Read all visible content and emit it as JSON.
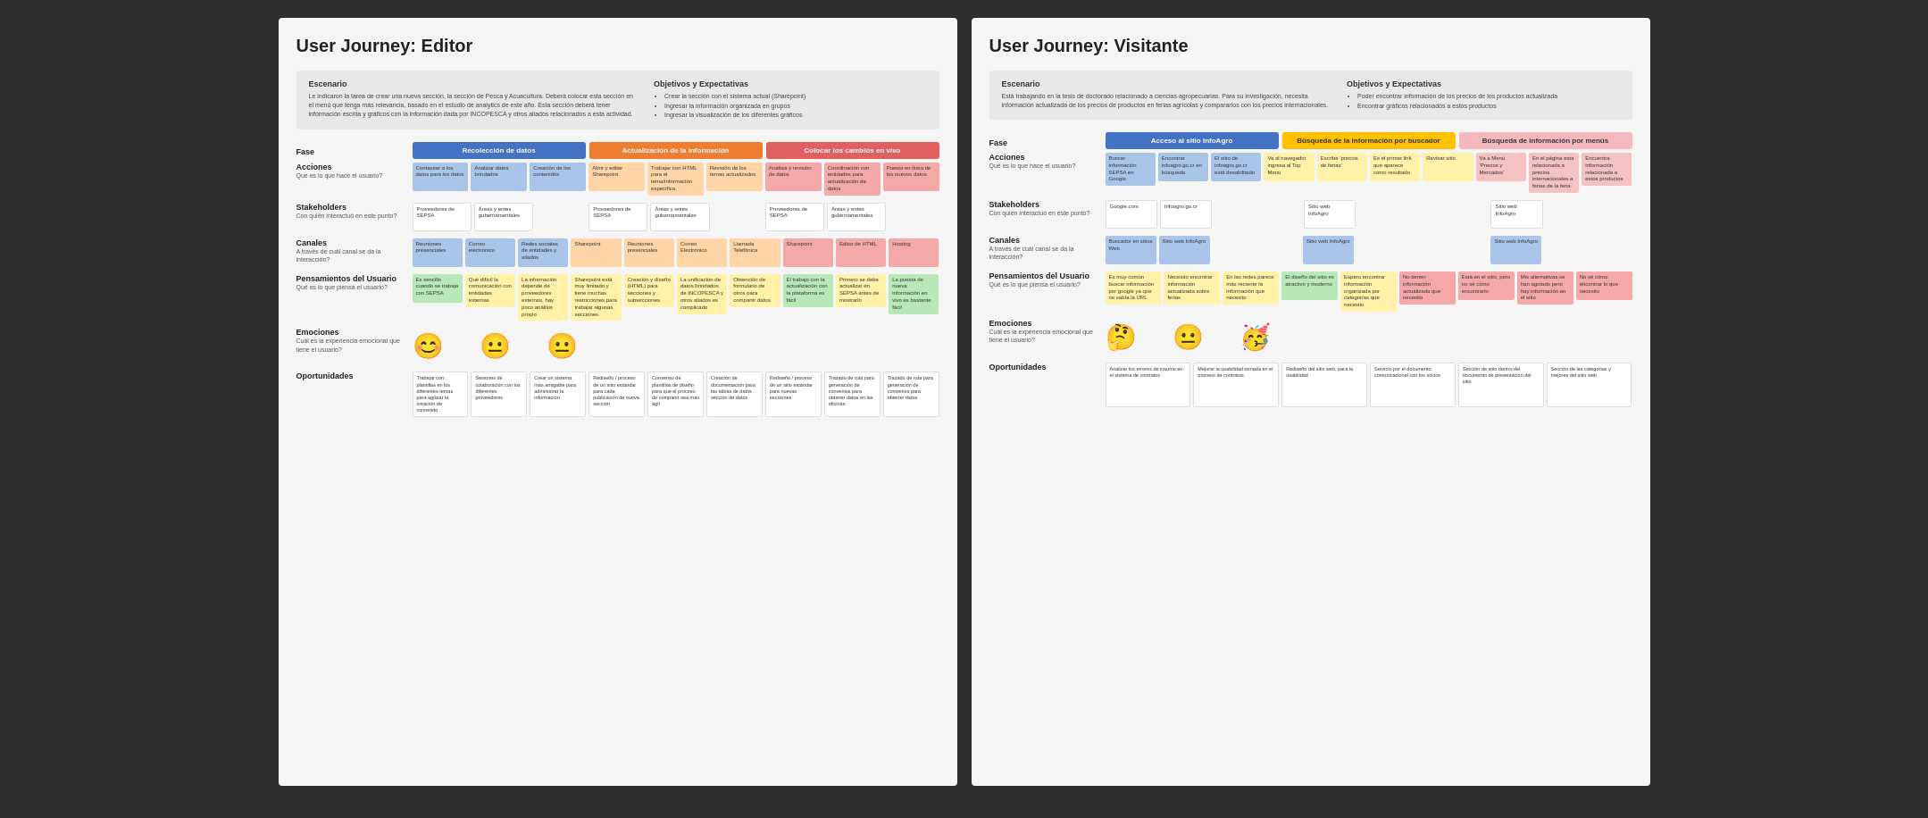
{
  "board1": {
    "title": "User Journey: Editor",
    "scenario": {
      "left_title": "Escenario",
      "left_text": "Le indicaron la tarea de crear una nueva sección, la sección de Pesca y Acuacultura. Deberá colocar esta sección en el menú que tenga más relevancia, basado en el estudio de analytics de este año. Esta sección deberá tener información escrita y gráficos con la información dada por INCOPESCA y otros aliados relacionados a esta actividad.",
      "right_title": "Objetivos y Expectativas",
      "right_items": [
        "Crear la sección con el sistema actual (Sharepoint)",
        "Ingresar la información organizada en grupos",
        "Ingresar la visualización de los diferentes gráficos"
      ]
    },
    "phases": {
      "label": "Fase",
      "items": [
        "Recolección de datos",
        "Actualización de la información",
        "Colocar los cambios en vivo"
      ]
    },
    "acciones": {
      "title": "Acciones",
      "subtitle": "Qué es lo que hace el usuario?",
      "col1": [
        "Contacear a los datos para los datos",
        "Analizar datos brindados",
        "Creación de los contenidos"
      ],
      "col2": [
        "Abrir y editar Sharepoint",
        "Trabajar con HTML para el tema/información específica",
        "Revisión de los temas actualizados"
      ],
      "col3": [
        "Análisis y revisión de datos",
        "Coordinación con entidades para actualización de datos",
        "Puesta en linea de los nuevos datos"
      ]
    },
    "stakeholders": {
      "title": "Stakeholders",
      "subtitle": "Con quién interactuó en este punto?",
      "col1": [
        "Proveedores de SEPSA",
        "Áreas y entes gubernamentales"
      ],
      "col2": [
        "Proveedores de SEPSA",
        "Áreas y entes gubernamentales"
      ],
      "col3": [
        "Proveedores de SEPSA",
        "Áreas y entes gubernamentales"
      ]
    },
    "canales": {
      "title": "Canales",
      "subtitle": "A través de cuál canal se da la interacción?",
      "col1": [
        "Reuniones presenciales",
        "Correo electrónico",
        "Redes sociales de entidades y aliados"
      ],
      "col2": [
        "Sharepoint",
        "Reuniones presenciales",
        "Correo Electrónico",
        "Llamada Telefónica"
      ],
      "col3": [
        "Sharepoint",
        "Editor de HTML",
        "Hosting"
      ]
    },
    "pensamientos": {
      "title": "Pensamientos del Usuario",
      "subtitle": "Qué es lo que piensa el usuario?",
      "col1": [
        "Es sencillo cuando se trabaja con SEPSA",
        "Qué difícil la comunicación con entidades externas",
        "La información depende de proveedores externos, hay poco análisis propio"
      ],
      "col2": [
        "Sharepoint está muy limitado y tiene muchas restricciones para trabajar algunas secciones",
        "Creación y diseño (HTML) para secciones y subsecciones",
        "La unificación de datos brindados de INCOPESCA y otros aliados es complicado",
        "Obtención de formulario de otros para compartir datos"
      ],
      "col3": [
        "El trabajo con la actualización con la plataforma es fácil",
        "Primero se debe actualizar en SEPSA antes de mostrarlo",
        "La puesta de nueva información en vivo es bastante fácil"
      ]
    },
    "emociones": {
      "title": "Emociones",
      "subtitle": "Cuál es la experiencia emocional que tiene el usuario?",
      "emojis": [
        "😊",
        "😐",
        "😐"
      ]
    },
    "oportunidades": {
      "title": "Oportunidades",
      "items": [
        "Trabajar con plantillas en los diferentes temas para agilizar la creación de contenido",
        "Sesiones de colaboración con los diferentes proveedores",
        "Crear un sistema más amigable para administrar la información",
        "Rediseño / proceso de un sitio estándar para cada publicación de nueva sección",
        "Consenso de plantillas de diseño para que el proceso de compartir sea más ágil",
        "Creación de documentación para las tablas de datos sección de datos",
        "Rediseño / proceso de un sitio estándar para nuevas secciones",
        "Trazado de ruta para generación de convenios para obtener datos en las oficinas",
        "Trazado de ruta para generación de convenios para obtener datos"
      ]
    }
  },
  "board2": {
    "title": "User Journey: Visitante",
    "scenario": {
      "left_title": "Escenario",
      "left_text": "Está trabajando en la tesis de doctorado relacionado a ciencias agropecuarias. Para su investigación, necesita información actualizada de los precios de productos en ferias agrícolas y compararlos con los precios internacionales.",
      "right_title": "Objetivos y Expectativas",
      "right_items": [
        "Poder encontrar información de los precios de los productos actualizada",
        "Encontrar gráficos relacionados a estos productos"
      ]
    },
    "phases": {
      "label": "Fase",
      "items": [
        "Acceso al sitio InfoAgro",
        "Búsqueda de la información por buscador",
        "Búsqueda de información por menús"
      ]
    },
    "acciones": {
      "title": "Acciones",
      "subtitle": "Qué es lo que hace el usuario?",
      "col1": [
        "Buscar información SEPSA en Google",
        "Encontrar infoagro.go.cr en búsqueda",
        "El sitio de infoagro.go.cr está desabilitado"
      ],
      "col2": [
        "Va al navegador ingresa al Top Menú",
        "Escribe 'precios de ferias'",
        "Es el primer link que aparece como resultado",
        "Revisar sitio"
      ],
      "col3": [
        "Va a Menú 'Precios y Mercados'",
        "En el página esta relacionada a precios internacionales a ferias de la feria",
        "Encuentra información relacionada a estos productos"
      ]
    },
    "stakeholders": {
      "title": "Stakeholders",
      "subtitle": "Con quién interactuó en este punto?",
      "col1": [
        "Google.com",
        "Infoagro.go.cr"
      ],
      "col2": [
        "Sitio web InfoAgro"
      ],
      "col3": [
        "Sitio web InfoAgro"
      ]
    },
    "canales": {
      "title": "Canales",
      "subtitle": "A través de cuál canal se da la interacción?",
      "col1": [
        "Buscador en sitios Web",
        "Sitio web InfoAgro"
      ],
      "col2": [
        "Sitio web InfoAgro"
      ],
      "col3": [
        "Sitio web InfoAgro"
      ]
    },
    "pensamientos": {
      "title": "Pensamientos del Usuario",
      "subtitle": "Qué es lo que piensa el usuario?",
      "col1": [
        "Es muy común buscar información por google ya que no sabía la URL",
        "Necesito encontrar información actualizada sobre ferias",
        "En las redes parece más reciente la información que necesito"
      ],
      "col2": [
        "El diseño del sitio es atractivo y moderno",
        "Espero encontrar información organizada por categorías que necesito",
        "No tienen información actualizada que necesito",
        "Está en el sitio, pero no sé cómo encontrarlo"
      ],
      "col3": [
        "Mis alternativas se han agotado pero hay información en el sitio",
        "No sé cómo encontrar lo que necesito"
      ]
    },
    "emociones": {
      "title": "Emociones",
      "subtitle": "Cuál es la experiencia emocional que tiene el usuario?",
      "emojis": [
        "🤔",
        "😐",
        "🥳"
      ]
    },
    "oportunidades": {
      "title": "Oportunidades",
      "items": [
        "Analizar los errores de insumo en el sistema de contratos",
        "Mejorar la usabilidad tomada en el proceso de contratos",
        "Rediseño del sitio web, para la usabilidad",
        "Servicio por el documento comunicacional con los socios",
        "Sección de sitio dentro del documento de presentación del sitio",
        "Sección de las categorías y mejores del sitio web"
      ]
    }
  }
}
